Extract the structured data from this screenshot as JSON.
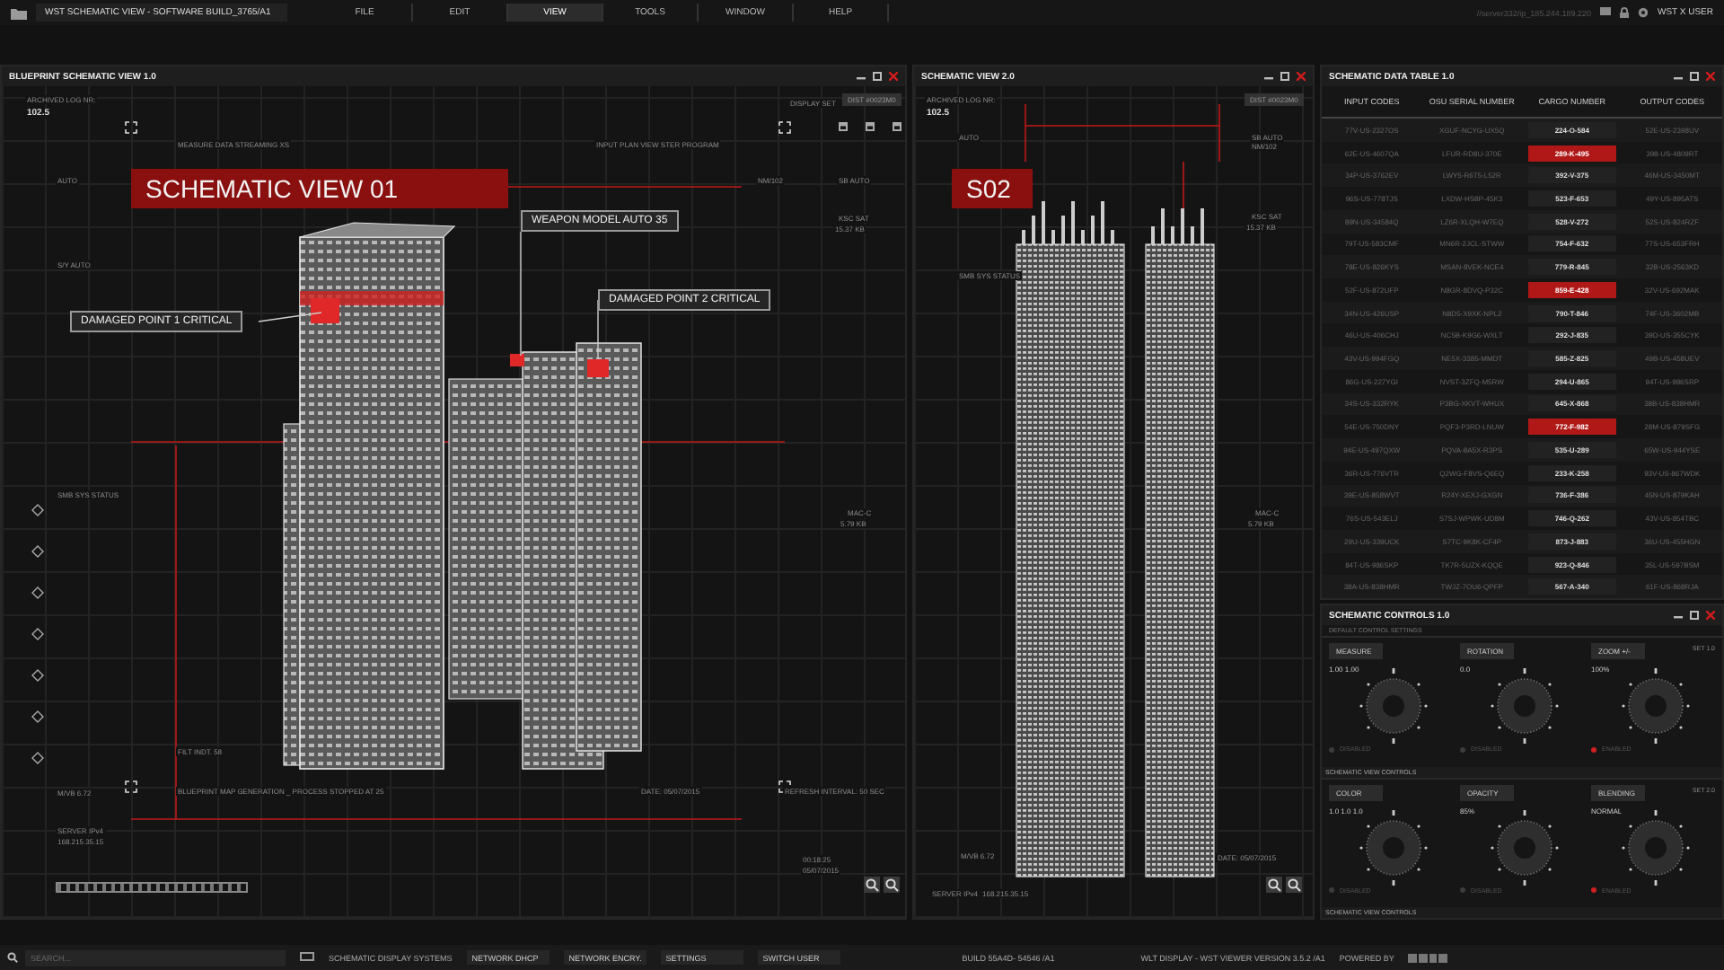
{
  "app": {
    "title": "WST SCHEMATIC VIEW - SOFTWARE BUILD_3765/A1",
    "server": "//server332/ip_185.244.189.220",
    "user": "WST X USER",
    "menu": [
      {
        "label": "FILE",
        "selected": false
      },
      {
        "label": "EDIT",
        "selected": false
      },
      {
        "label": "VIEW",
        "selected": true
      },
      {
        "label": "TOOLS",
        "selected": false
      },
      {
        "label": "WINDOW",
        "selected": false
      },
      {
        "label": "HELP",
        "selected": false
      }
    ]
  },
  "blueprint": {
    "title": "BLUEPRINT SCHEMATIC VIEW 1.0",
    "log_label": "ARCHIVED LOG NR:",
    "log_value": "102.5",
    "display_set_label": "DISPLAY SET",
    "display_set_value": "DIST #0023M0",
    "banner": "SCHEMATIC VIEW 01",
    "callouts": [
      "WEAPON MODEL AUTO 35",
      "DAMAGED POINT 1 CRITICAL",
      "DAMAGED POINT 2 CRITICAL"
    ],
    "labels": [
      "MEASURE DATA STREAMING XS",
      "INPUT PLAN VIEW STER PROGRAM",
      "AUTO",
      "NM/102",
      "SB AUTO",
      "KSC SAT",
      "15.37 KB",
      "S/Y AUTO",
      "SMB SYS STATUS",
      "MAC-C",
      "5.79 KB",
      "FILT INDT. 58",
      "M/VB 6.72",
      "BLUEPRINT MAP GENERATION _ PROCESS STOPPED AT 25",
      "DATE: 05/07/2015",
      "REFRESH INTERVAL: 50 SEC",
      "SERVER IPv4",
      "168.215.35.15",
      "00:18:25",
      "05/07/2015"
    ]
  },
  "schematic2": {
    "title": "SCHEMATIC VIEW 2.0",
    "log_label": "ARCHIVED LOG NR:",
    "log_value": "102.5",
    "display_set_value": "DIST #0023M0",
    "banner": "S02",
    "labels": [
      "AUTO",
      "SB AUTO",
      "NM/102",
      "KSC SAT",
      "15.37 KB",
      "SMB SYS STATUS",
      "MAC-C",
      "5.79 KB",
      "M/VB 6.72",
      "DATE: 05/07/2015",
      "SERVER IPv4",
      "168.215.35.15"
    ]
  },
  "data_table": {
    "title": "SCHEMATIC DATA TABLE 1.0",
    "columns": [
      "INPUT CODES",
      "OSU SERIAL NUMBER",
      "CARGO NUMBER",
      "OUTPUT CODES"
    ],
    "rows": [
      {
        "cells": [
          "77V-US-2327OS",
          "XGUF-NCYG-UX5Q",
          "224-O-584",
          "52E-US-2398UV"
        ],
        "selected": false
      },
      {
        "cells": [
          "62E-US-4607QA",
          "LFUR-RD8U-370E",
          "289-K-495",
          "398-US-4809RT"
        ],
        "selected": true
      },
      {
        "cells": [
          "34P-US-3762EV",
          "LWY5-R6T5-L52R",
          "392-V-375",
          "46M-US-3450MT"
        ],
        "selected": false
      },
      {
        "cells": [
          "96S-US-778TJS",
          "LXDW-HS8P-45K3",
          "523-F-653",
          "49Y-US-895ATS"
        ],
        "selected": false
      },
      {
        "cells": [
          "89N-US-34584Q",
          "LZ6R-XLQH-W7EQ",
          "528-V-272",
          "52S-US-824RZF"
        ],
        "selected": false
      },
      {
        "cells": [
          "79T-US-583CMF",
          "MN6R-2JCL-STWW",
          "754-F-632",
          "77S-US-653FRH"
        ],
        "selected": false
      },
      {
        "cells": [
          "78E-US-826KYS",
          "MSAN-8VEK-NCE4",
          "779-R-845",
          "32B-US-2563KD"
        ],
        "selected": false
      },
      {
        "cells": [
          "52F-US-872UFP",
          "N8GR-8DVQ-P32C",
          "859-E-428",
          "32V-US-692MAK"
        ],
        "selected": true
      },
      {
        "cells": [
          "34N-US-426USP",
          "N8D5-X9XK-NPL2",
          "790-T-846",
          "74F-US-3602MB"
        ],
        "selected": false
      },
      {
        "cells": [
          "46U-US-406CHJ",
          "NC5B-K9G6-WXLT",
          "292-J-835",
          "39D-US-355CYK"
        ],
        "selected": false
      },
      {
        "cells": [
          "43V-US-994FGQ",
          "NE5X-3385-MMDT",
          "585-Z-825",
          "49B-US-458UEV"
        ],
        "selected": false
      },
      {
        "cells": [
          "86G-US-227YGI",
          "NVST-3ZFQ-M5RW",
          "294-U-865",
          "94T-US-986SRP"
        ],
        "selected": false
      },
      {
        "cells": [
          "34S-US-332RYK",
          "P3BG-XKVT-WHUX",
          "645-X-868",
          "38B-US-838HMR"
        ],
        "selected": false
      },
      {
        "cells": [
          "54E-US-750DNY",
          "PQF3-P3RD-LNUW",
          "772-F-982",
          "28M-US-879SFG"
        ],
        "selected": true
      },
      {
        "cells": [
          "94E-US-497QXW",
          "PQVA-8A5X-R3PS",
          "535-U-289",
          "65W-US-944YSE"
        ],
        "selected": false
      },
      {
        "cells": [
          "36R-US-776VTR",
          "Q2WG-F8VS-Q6EQ",
          "233-K-258",
          "93V-US-867WDK"
        ],
        "selected": false
      },
      {
        "cells": [
          "39E-US-858WVT",
          "R24Y-XEXJ-GXGN",
          "736-F-386",
          "45N-US-879KAH"
        ],
        "selected": false
      },
      {
        "cells": [
          "76S-US-543ELJ",
          "S7SJ-WPWK-UD8M",
          "746-Q-262",
          "43V-US-854TBC"
        ],
        "selected": false
      },
      {
        "cells": [
          "29U-US-339UCK",
          "S7TC-9K8K-CF4P",
          "873-J-883",
          "36U-US-455HGN"
        ],
        "selected": false
      },
      {
        "cells": [
          "84T-US-986SKP",
          "TK7R-5UZX-KQQE",
          "923-Q-846",
          "35L-US-597BSM"
        ],
        "selected": false
      },
      {
        "cells": [
          "38A-US-838HMR",
          "TWJZ-7OU6-QPFP",
          "567-A-340",
          "61F-US-868RJA"
        ],
        "selected": false
      }
    ]
  },
  "controls": {
    "title": "SCHEMATIC CONTROLS 1.0",
    "subtitle": "DEFAULT CONTROL SETTINGS",
    "sections": [
      {
        "set": "SET 1.0",
        "footer": "SCHEMATIC VIEW CONTROLS",
        "knobs": [
          {
            "label": "MEASURE",
            "value": "1.00 1.00",
            "enabled": false,
            "status": "DISABLED"
          },
          {
            "label": "ROTATION",
            "value": "0.0",
            "enabled": false,
            "status": "DISABLED"
          },
          {
            "label": "ZOOM +/-",
            "value": "100%",
            "enabled": true,
            "status": "ENABLED"
          }
        ]
      },
      {
        "set": "SET 2.0",
        "footer": "SCHEMATIC VIEW CONTROLS",
        "knobs": [
          {
            "label": "COLOR",
            "value": "1.0 1.0 1.0",
            "enabled": false,
            "status": "DISABLED"
          },
          {
            "label": "OPACITY",
            "value": "85%",
            "enabled": false,
            "status": "DISABLED"
          },
          {
            "label": "BLENDING",
            "value": "NORMAL",
            "enabled": true,
            "status": "ENABLED"
          }
        ]
      }
    ]
  },
  "status_bar": {
    "search_placeholder": "SEARCH...",
    "system": "SCHEMATIC DISPLAY SYSTEMS",
    "buttons": [
      "NETWORK DHCP",
      "NETWORK ENCRY.",
      "SETTINGS",
      "SWITCH USER"
    ],
    "build": "BUILD 55A4D- 54546 /A1",
    "version": "WLT DISPLAY - WST VIEWER VERSION 3.5.2 /A1",
    "powered": "POWERED BY"
  }
}
